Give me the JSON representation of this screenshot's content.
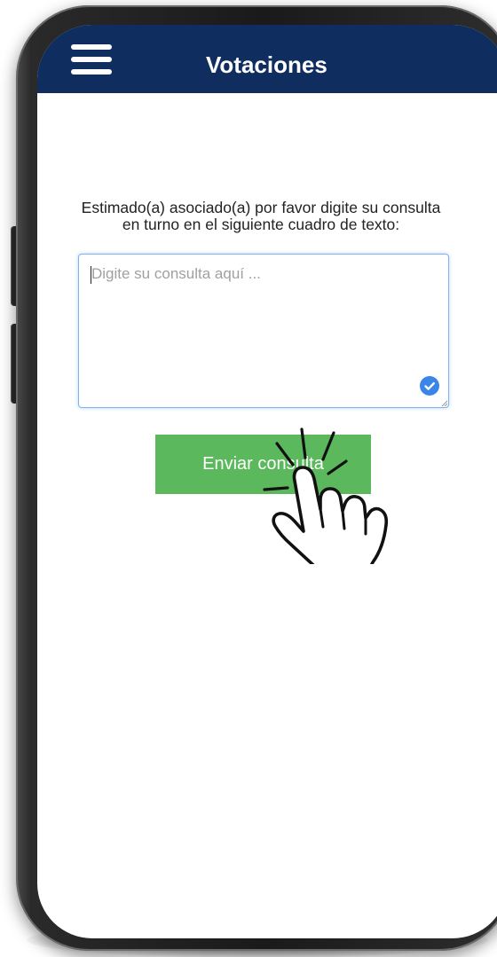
{
  "header": {
    "title": "Votaciones",
    "menu_icon": "hamburger-menu-icon",
    "background_color": "#0f2d5e"
  },
  "main": {
    "instruction": "Estimado(a) asociado(a) por favor digite su consulta en turno en el siguiente cuadro de texto:",
    "query_input": {
      "placeholder": "Digite su consulta aquí ...",
      "value": ""
    },
    "send_button": {
      "label": "Enviar consulta",
      "color": "#5cb85c"
    },
    "icons": [
      "hamburger-menu-icon",
      "check-circle-icon",
      "resize-handle-icon",
      "tap-hand-icon"
    ]
  }
}
